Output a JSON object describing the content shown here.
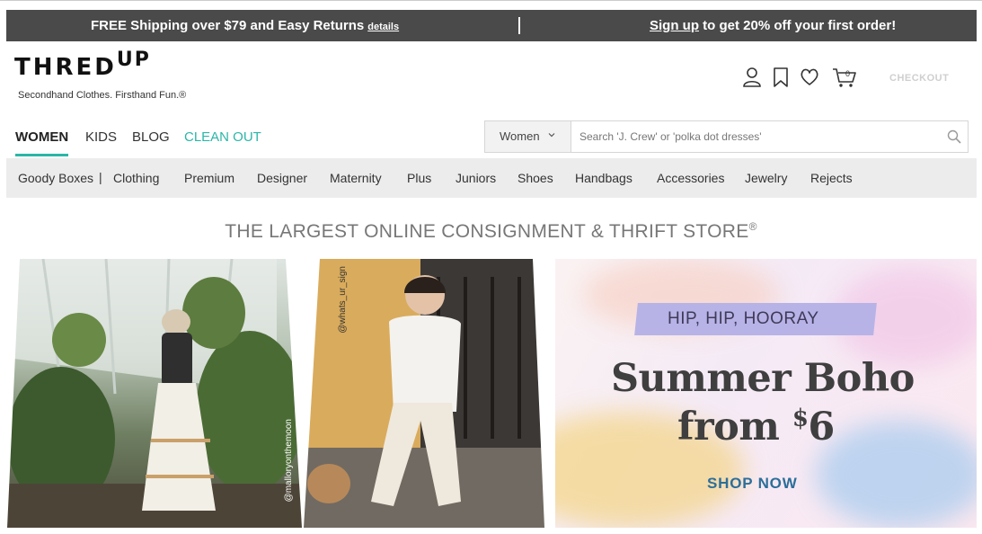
{
  "promo": {
    "left_text": "FREE Shipping over $79 and Easy Returns",
    "details_link": "details",
    "signup_link": "Sign up",
    "right_text": " to get 20% off your first order!"
  },
  "brand": {
    "logo_main": "THRED",
    "logo_up": "UP",
    "tagline": "Secondhand Clothes. Firsthand Fun.®"
  },
  "header": {
    "cart_count": "0",
    "checkout_label": "CHECKOUT",
    "icons": [
      "user-icon",
      "bookmark-icon",
      "heart-icon",
      "cart-icon"
    ]
  },
  "nav": {
    "tabs": [
      {
        "label": "WOMEN",
        "active": true
      },
      {
        "label": "KIDS"
      },
      {
        "label": "BLOG"
      },
      {
        "label": "CLEAN OUT",
        "color": "#2bb6a8"
      }
    ]
  },
  "search": {
    "department": "Women",
    "placeholder": "Search 'J. Crew' or 'polka dot dresses'"
  },
  "categories": [
    "Goody Boxes",
    "|",
    "Clothing",
    "Premium",
    "Designer",
    "Maternity",
    "Plus",
    "Juniors",
    "Shoes",
    "Handbags",
    "Accessories",
    "Jewelry",
    "Rejects"
  ],
  "store_title": "THE LARGEST ONLINE CONSIGNMENT & THRIFT STORE",
  "store_title_mark": "®",
  "banner": {
    "photo1_credit": "@malloryonthemoon",
    "photo2_credit": "@whats_ur_sign",
    "kicker": "HIP, HIP, HOORAY",
    "headline_line1": "Summer Boho",
    "headline_line2_prefix": "from ",
    "headline_price_symbol": "$",
    "headline_price": "6",
    "cta": "SHOP NOW"
  },
  "colors": {
    "promo_bg": "#4a4a4a",
    "accent_teal": "#2bb6a8",
    "category_bar_bg": "#ececec",
    "kicker_bg": "#b7b3e6",
    "cta_blue": "#2c6e9a"
  }
}
